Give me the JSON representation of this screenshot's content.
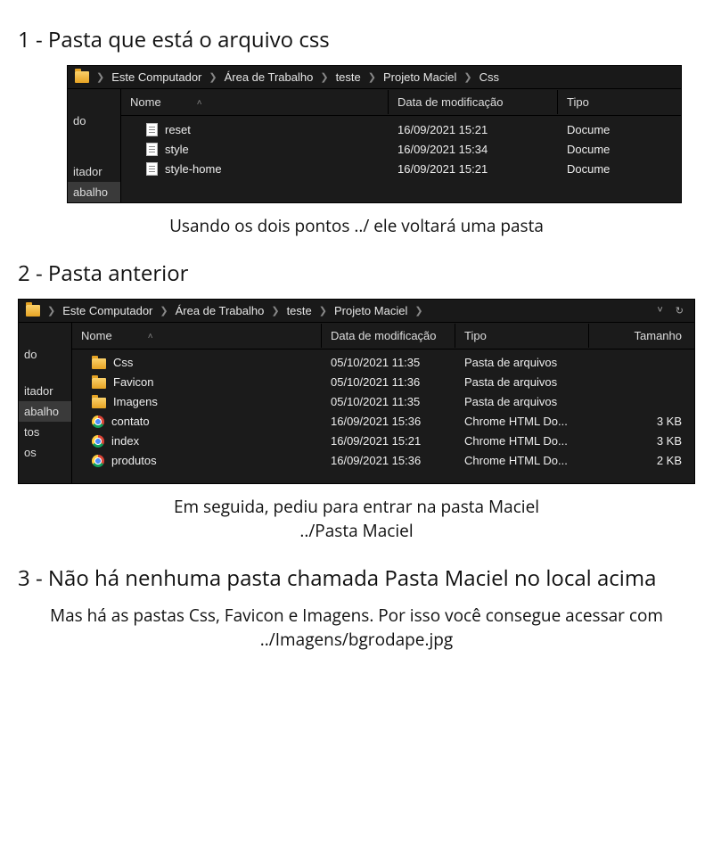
{
  "sections": {
    "s1": {
      "heading": "1 - Pasta que está o arquivo css",
      "caption": "Usando os dois pontos ../ ele voltará uma pasta"
    },
    "s2": {
      "heading": "2 - Pasta anterior",
      "caption_l1": "Em seguida, pediu para entrar na pasta Maciel",
      "caption_l2": "../Pasta Maciel"
    },
    "s3": {
      "heading": "3 - Não há nenhuma pasta chamada Pasta Maciel no local acima",
      "body": "Mas há as pastas Css, Favicon e Imagens. Por isso você consegue acessar com ../Imagens/bgrodape.jpg"
    }
  },
  "explorer1": {
    "breadcrumb": [
      "Este Computador",
      "Área de Trabalho",
      "teste",
      "Projeto Maciel",
      "Css"
    ],
    "columns": {
      "name": "Nome",
      "date": "Data de modificação",
      "type": "Tipo"
    },
    "sidebar": [
      "do",
      "",
      "itador",
      "abalho"
    ],
    "rows": [
      {
        "icon": "doc",
        "name": "reset",
        "date": "16/09/2021 15:21",
        "type": "Docume"
      },
      {
        "icon": "doc",
        "name": "style",
        "date": "16/09/2021 15:34",
        "type": "Docume"
      },
      {
        "icon": "doc",
        "name": "style-home",
        "date": "16/09/2021 15:21",
        "type": "Docume"
      }
    ]
  },
  "explorer2": {
    "breadcrumb": [
      "Este Computador",
      "Área de Trabalho",
      "teste",
      "Projeto Maciel"
    ],
    "columns": {
      "name": "Nome",
      "date": "Data de modificação",
      "type": "Tipo",
      "size": "Tamanho"
    },
    "sidebar": [
      "do",
      "",
      "itador",
      "abalho",
      "tos",
      "os"
    ],
    "sidebar_selected_index": 3,
    "rows": [
      {
        "icon": "folder",
        "name": "Css",
        "date": "05/10/2021 11:35",
        "type": "Pasta de arquivos",
        "size": ""
      },
      {
        "icon": "folder",
        "name": "Favicon",
        "date": "05/10/2021 11:36",
        "type": "Pasta de arquivos",
        "size": ""
      },
      {
        "icon": "folder",
        "name": "Imagens",
        "date": "05/10/2021 11:35",
        "type": "Pasta de arquivos",
        "size": ""
      },
      {
        "icon": "chrome",
        "name": "contato",
        "date": "16/09/2021 15:36",
        "type": "Chrome HTML Do...",
        "size": "3 KB"
      },
      {
        "icon": "chrome",
        "name": "index",
        "date": "16/09/2021 15:21",
        "type": "Chrome HTML Do...",
        "size": "3 KB"
      },
      {
        "icon": "chrome",
        "name": "produtos",
        "date": "16/09/2021 15:36",
        "type": "Chrome HTML Do...",
        "size": "2 KB"
      }
    ]
  }
}
